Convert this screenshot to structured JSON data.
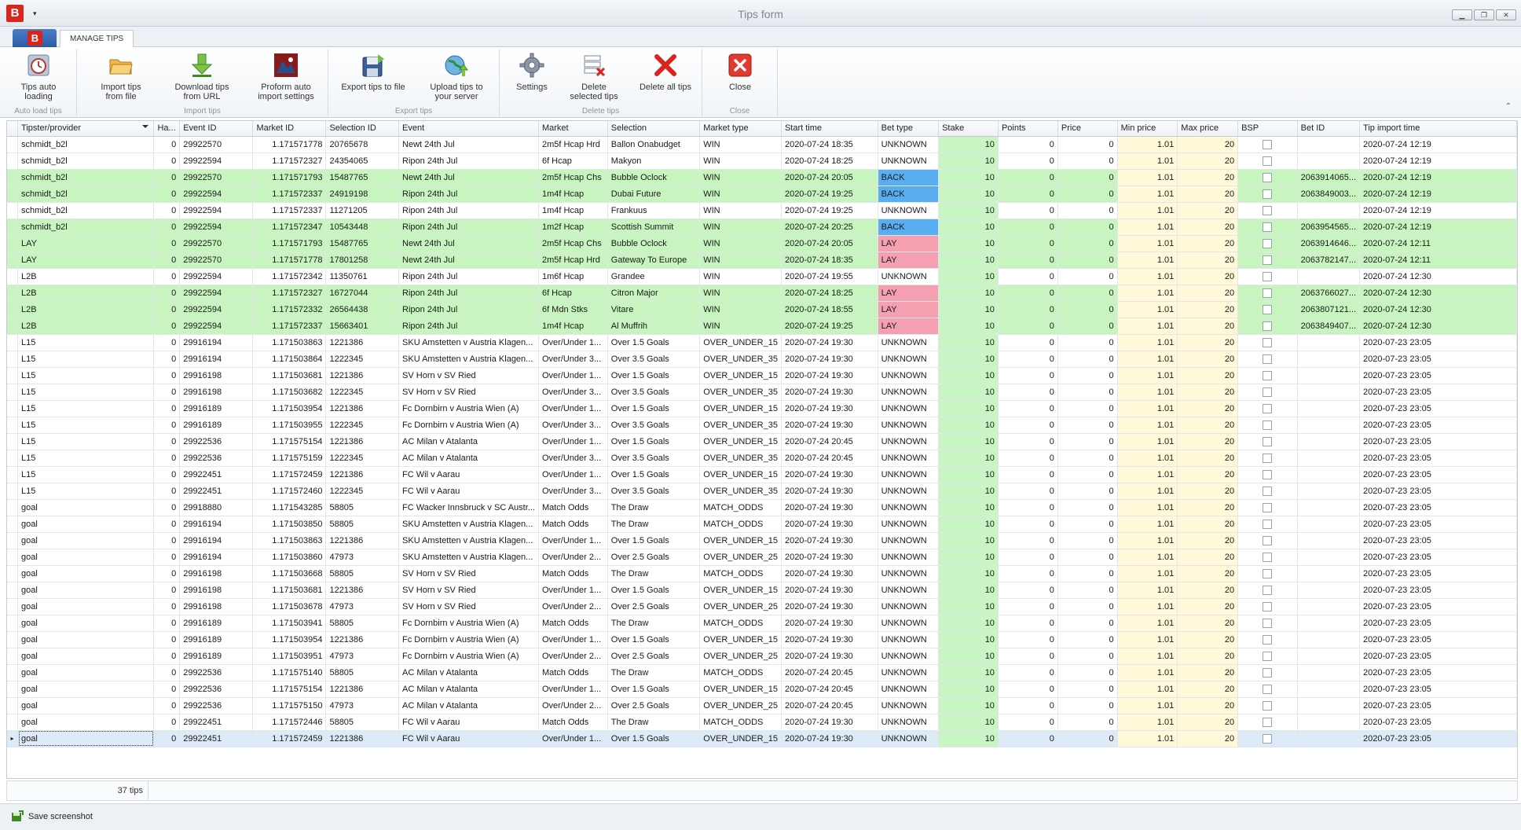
{
  "window": {
    "title": "Tips form",
    "logo_letter": "B",
    "qat_arrow": "▾",
    "min": "▁",
    "restore": "❐",
    "close": "✕"
  },
  "ribbon": {
    "app_button_letter": "B",
    "tab_label": "MANAGE TIPS",
    "groups": {
      "auto_load": {
        "label": "Auto load tips",
        "btn1": "Tips auto\nloading"
      },
      "import": {
        "label": "Import tips",
        "btn1": "Import tips\nfrom file",
        "btn2": "Download tips\nfrom URL",
        "btn3": "Proform auto\nimport settings"
      },
      "export": {
        "label": "Export tips",
        "btn1": "Export tips to file",
        "btn2": "Upload tips to\nyour server"
      },
      "delete": {
        "label": "Delete tips",
        "btn1": "Settings",
        "btn2": "Delete\nselected tips",
        "btn3": "Delete all tips"
      },
      "close": {
        "label": "Close",
        "btn1": "Close"
      }
    },
    "collapse": "⌃"
  },
  "grid": {
    "columns": [
      "",
      "Tipster/provider",
      "Ha...",
      "Event ID",
      "Market ID",
      "Selection ID",
      "Event",
      "Market",
      "Selection",
      "Market type",
      "Start time",
      "Bet type",
      "Stake",
      "Points",
      "Price",
      "Min price",
      "Max price",
      "BSP",
      "Bet ID",
      "Tip import time"
    ],
    "rows": [
      {
        "g": 0,
        "c": [
          "schmidt_b2l",
          "0",
          "29922570",
          "1.171571778",
          "20765678",
          "Newt  24th Jul",
          "2m5f Hcap Hrd",
          "Ballon Onabudget",
          "WIN",
          "2020-07-24 18:35",
          "UNKNOWN",
          "10",
          "0",
          "0",
          "1.01",
          "20",
          "",
          "",
          "2020-07-24 12:19"
        ]
      },
      {
        "g": 0,
        "c": [
          "schmidt_b2l",
          "0",
          "29922594",
          "1.171572327",
          "24354065",
          "Ripon 24th Jul",
          "6f Hcap",
          "Makyon",
          "WIN",
          "2020-07-24 18:25",
          "UNKNOWN",
          "10",
          "0",
          "0",
          "1.01",
          "20",
          "",
          "",
          "2020-07-24 12:19"
        ]
      },
      {
        "g": 1,
        "c": [
          "schmidt_b2l",
          "0",
          "29922570",
          "1.171571793",
          "15487765",
          "Newt  24th Jul",
          "2m5f Hcap Chs",
          "Bubble Oclock",
          "WIN",
          "2020-07-24 20:05",
          "BACK",
          "10",
          "0",
          "0",
          "1.01",
          "20",
          "",
          "2063914065...",
          "2020-07-24 12:19"
        ]
      },
      {
        "g": 1,
        "c": [
          "schmidt_b2l",
          "0",
          "29922594",
          "1.171572337",
          "24919198",
          "Ripon 24th Jul",
          "1m4f Hcap",
          "Dubai Future",
          "WIN",
          "2020-07-24 19:25",
          "BACK",
          "10",
          "0",
          "0",
          "1.01",
          "20",
          "",
          "2063849003...",
          "2020-07-24 12:19"
        ]
      },
      {
        "g": 0,
        "c": [
          "schmidt_b2l",
          "0",
          "29922594",
          "1.171572337",
          "11271205",
          "Ripon 24th Jul",
          "1m4f Hcap",
          "Frankuus",
          "WIN",
          "2020-07-24 19:25",
          "UNKNOWN",
          "10",
          "0",
          "0",
          "1.01",
          "20",
          "",
          "",
          "2020-07-24 12:19"
        ]
      },
      {
        "g": 1,
        "c": [
          "schmidt_b2l",
          "0",
          "29922594",
          "1.171572347",
          "10543448",
          "Ripon 24th Jul",
          "1m2f Hcap",
          "Scottish Summit",
          "WIN",
          "2020-07-24 20:25",
          "BACK",
          "10",
          "0",
          "0",
          "1.01",
          "20",
          "",
          "2063954565...",
          "2020-07-24 12:19"
        ]
      },
      {
        "g": 1,
        "c": [
          "LAY",
          "0",
          "29922570",
          "1.171571793",
          "15487765",
          "Newt  24th Jul",
          "2m5f Hcap Chs",
          "Bubble Oclock",
          "WIN",
          "2020-07-24 20:05",
          "LAY",
          "10",
          "0",
          "0",
          "1.01",
          "20",
          "",
          "2063914646...",
          "2020-07-24 12:11"
        ]
      },
      {
        "g": 1,
        "c": [
          "LAY",
          "0",
          "29922570",
          "1.171571778",
          "17801258",
          "Newt  24th Jul",
          "2m5f Hcap Hrd",
          "Gateway To Europe",
          "WIN",
          "2020-07-24 18:35",
          "LAY",
          "10",
          "0",
          "0",
          "1.01",
          "20",
          "",
          "2063782147...",
          "2020-07-24 12:11"
        ]
      },
      {
        "g": 0,
        "c": [
          "L2B",
          "0",
          "29922594",
          "1.171572342",
          "11350761",
          "Ripon 24th Jul",
          "1m6f Hcap",
          "Grandee",
          "WIN",
          "2020-07-24 19:55",
          "UNKNOWN",
          "10",
          "0",
          "0",
          "1.01",
          "20",
          "",
          "",
          "2020-07-24 12:30"
        ]
      },
      {
        "g": 1,
        "c": [
          "L2B",
          "0",
          "29922594",
          "1.171572327",
          "16727044",
          "Ripon 24th Jul",
          "6f Hcap",
          "Citron Major",
          "WIN",
          "2020-07-24 18:25",
          "LAY",
          "10",
          "0",
          "0",
          "1.01",
          "20",
          "",
          "2063766027...",
          "2020-07-24 12:30"
        ]
      },
      {
        "g": 1,
        "c": [
          "L2B",
          "0",
          "29922594",
          "1.171572332",
          "26564438",
          "Ripon 24th Jul",
          "6f Mdn Stks",
          "Vitare",
          "WIN",
          "2020-07-24 18:55",
          "LAY",
          "10",
          "0",
          "0",
          "1.01",
          "20",
          "",
          "2063807121...",
          "2020-07-24 12:30"
        ]
      },
      {
        "g": 1,
        "c": [
          "L2B",
          "0",
          "29922594",
          "1.171572337",
          "15663401",
          "Ripon 24th Jul",
          "1m4f Hcap",
          "Al Muffrih",
          "WIN",
          "2020-07-24 19:25",
          "LAY",
          "10",
          "0",
          "0",
          "1.01",
          "20",
          "",
          "2063849407...",
          "2020-07-24 12:30"
        ]
      },
      {
        "g": 0,
        "c": [
          "L15",
          "0",
          "29916194",
          "1.171503863",
          "1221386",
          "SKU Amstetten v Austria Klagen...",
          "Over/Under 1...",
          "Over 1.5 Goals",
          "OVER_UNDER_15",
          "2020-07-24 19:30",
          "UNKNOWN",
          "10",
          "0",
          "0",
          "1.01",
          "20",
          "",
          "",
          "2020-07-23 23:05"
        ]
      },
      {
        "g": 0,
        "c": [
          "L15",
          "0",
          "29916194",
          "1.171503864",
          "1222345",
          "SKU Amstetten v Austria Klagen...",
          "Over/Under 3...",
          "Over 3.5 Goals",
          "OVER_UNDER_35",
          "2020-07-24 19:30",
          "UNKNOWN",
          "10",
          "0",
          "0",
          "1.01",
          "20",
          "",
          "",
          "2020-07-23 23:05"
        ]
      },
      {
        "g": 0,
        "c": [
          "L15",
          "0",
          "29916198",
          "1.171503681",
          "1221386",
          "SV Horn v SV Ried",
          "Over/Under 1...",
          "Over 1.5 Goals",
          "OVER_UNDER_15",
          "2020-07-24 19:30",
          "UNKNOWN",
          "10",
          "0",
          "0",
          "1.01",
          "20",
          "",
          "",
          "2020-07-23 23:05"
        ]
      },
      {
        "g": 0,
        "c": [
          "L15",
          "0",
          "29916198",
          "1.171503682",
          "1222345",
          "SV Horn v SV Ried",
          "Over/Under 3...",
          "Over 3.5 Goals",
          "OVER_UNDER_35",
          "2020-07-24 19:30",
          "UNKNOWN",
          "10",
          "0",
          "0",
          "1.01",
          "20",
          "",
          "",
          "2020-07-23 23:05"
        ]
      },
      {
        "g": 0,
        "c": [
          "L15",
          "0",
          "29916189",
          "1.171503954",
          "1221386",
          "Fc Dornbirn v Austria Wien (A)",
          "Over/Under 1...",
          "Over 1.5 Goals",
          "OVER_UNDER_15",
          "2020-07-24 19:30",
          "UNKNOWN",
          "10",
          "0",
          "0",
          "1.01",
          "20",
          "",
          "",
          "2020-07-23 23:05"
        ]
      },
      {
        "g": 0,
        "c": [
          "L15",
          "0",
          "29916189",
          "1.171503955",
          "1222345",
          "Fc Dornbirn v Austria Wien (A)",
          "Over/Under 3...",
          "Over 3.5 Goals",
          "OVER_UNDER_35",
          "2020-07-24 19:30",
          "UNKNOWN",
          "10",
          "0",
          "0",
          "1.01",
          "20",
          "",
          "",
          "2020-07-23 23:05"
        ]
      },
      {
        "g": 0,
        "c": [
          "L15",
          "0",
          "29922536",
          "1.171575154",
          "1221386",
          "AC Milan v Atalanta",
          "Over/Under 1...",
          "Over 1.5 Goals",
          "OVER_UNDER_15",
          "2020-07-24 20:45",
          "UNKNOWN",
          "10",
          "0",
          "0",
          "1.01",
          "20",
          "",
          "",
          "2020-07-23 23:05"
        ]
      },
      {
        "g": 0,
        "c": [
          "L15",
          "0",
          "29922536",
          "1.171575159",
          "1222345",
          "AC Milan v Atalanta",
          "Over/Under 3...",
          "Over 3.5 Goals",
          "OVER_UNDER_35",
          "2020-07-24 20:45",
          "UNKNOWN",
          "10",
          "0",
          "0",
          "1.01",
          "20",
          "",
          "",
          "2020-07-23 23:05"
        ]
      },
      {
        "g": 0,
        "c": [
          "L15",
          "0",
          "29922451",
          "1.171572459",
          "1221386",
          "FC Wil v Aarau",
          "Over/Under 1...",
          "Over 1.5 Goals",
          "OVER_UNDER_15",
          "2020-07-24 19:30",
          "UNKNOWN",
          "10",
          "0",
          "0",
          "1.01",
          "20",
          "",
          "",
          "2020-07-23 23:05"
        ]
      },
      {
        "g": 0,
        "c": [
          "L15",
          "0",
          "29922451",
          "1.171572460",
          "1222345",
          "FC Wil v Aarau",
          "Over/Under 3...",
          "Over 3.5 Goals",
          "OVER_UNDER_35",
          "2020-07-24 19:30",
          "UNKNOWN",
          "10",
          "0",
          "0",
          "1.01",
          "20",
          "",
          "",
          "2020-07-23 23:05"
        ]
      },
      {
        "g": 0,
        "c": [
          "goal",
          "0",
          "29918880",
          "1.171543285",
          "58805",
          "FC Wacker Innsbruck v SC Austr...",
          "Match Odds",
          "The Draw",
          "MATCH_ODDS",
          "2020-07-24 19:30",
          "UNKNOWN",
          "10",
          "0",
          "0",
          "1.01",
          "20",
          "",
          "",
          "2020-07-23 23:05"
        ]
      },
      {
        "g": 0,
        "c": [
          "goal",
          "0",
          "29916194",
          "1.171503850",
          "58805",
          "SKU Amstetten v Austria Klagen...",
          "Match Odds",
          "The Draw",
          "MATCH_ODDS",
          "2020-07-24 19:30",
          "UNKNOWN",
          "10",
          "0",
          "0",
          "1.01",
          "20",
          "",
          "",
          "2020-07-23 23:05"
        ]
      },
      {
        "g": 0,
        "c": [
          "goal",
          "0",
          "29916194",
          "1.171503863",
          "1221386",
          "SKU Amstetten v Austria Klagen...",
          "Over/Under 1...",
          "Over 1.5 Goals",
          "OVER_UNDER_15",
          "2020-07-24 19:30",
          "UNKNOWN",
          "10",
          "0",
          "0",
          "1.01",
          "20",
          "",
          "",
          "2020-07-23 23:05"
        ]
      },
      {
        "g": 0,
        "c": [
          "goal",
          "0",
          "29916194",
          "1.171503860",
          "47973",
          "SKU Amstetten v Austria Klagen...",
          "Over/Under 2...",
          "Over 2.5 Goals",
          "OVER_UNDER_25",
          "2020-07-24 19:30",
          "UNKNOWN",
          "10",
          "0",
          "0",
          "1.01",
          "20",
          "",
          "",
          "2020-07-23 23:05"
        ]
      },
      {
        "g": 0,
        "c": [
          "goal",
          "0",
          "29916198",
          "1.171503668",
          "58805",
          "SV Horn v SV Ried",
          "Match Odds",
          "The Draw",
          "MATCH_ODDS",
          "2020-07-24 19:30",
          "UNKNOWN",
          "10",
          "0",
          "0",
          "1.01",
          "20",
          "",
          "",
          "2020-07-23 23:05"
        ]
      },
      {
        "g": 0,
        "c": [
          "goal",
          "0",
          "29916198",
          "1.171503681",
          "1221386",
          "SV Horn v SV Ried",
          "Over/Under 1...",
          "Over 1.5 Goals",
          "OVER_UNDER_15",
          "2020-07-24 19:30",
          "UNKNOWN",
          "10",
          "0",
          "0",
          "1.01",
          "20",
          "",
          "",
          "2020-07-23 23:05"
        ]
      },
      {
        "g": 0,
        "c": [
          "goal",
          "0",
          "29916198",
          "1.171503678",
          "47973",
          "SV Horn v SV Ried",
          "Over/Under 2...",
          "Over 2.5 Goals",
          "OVER_UNDER_25",
          "2020-07-24 19:30",
          "UNKNOWN",
          "10",
          "0",
          "0",
          "1.01",
          "20",
          "",
          "",
          "2020-07-23 23:05"
        ]
      },
      {
        "g": 0,
        "c": [
          "goal",
          "0",
          "29916189",
          "1.171503941",
          "58805",
          "Fc Dornbirn v Austria Wien (A)",
          "Match Odds",
          "The Draw",
          "MATCH_ODDS",
          "2020-07-24 19:30",
          "UNKNOWN",
          "10",
          "0",
          "0",
          "1.01",
          "20",
          "",
          "",
          "2020-07-23 23:05"
        ]
      },
      {
        "g": 0,
        "c": [
          "goal",
          "0",
          "29916189",
          "1.171503954",
          "1221386",
          "Fc Dornbirn v Austria Wien (A)",
          "Over/Under 1...",
          "Over 1.5 Goals",
          "OVER_UNDER_15",
          "2020-07-24 19:30",
          "UNKNOWN",
          "10",
          "0",
          "0",
          "1.01",
          "20",
          "",
          "",
          "2020-07-23 23:05"
        ]
      },
      {
        "g": 0,
        "c": [
          "goal",
          "0",
          "29916189",
          "1.171503951",
          "47973",
          "Fc Dornbirn v Austria Wien (A)",
          "Over/Under 2...",
          "Over 2.5 Goals",
          "OVER_UNDER_25",
          "2020-07-24 19:30",
          "UNKNOWN",
          "10",
          "0",
          "0",
          "1.01",
          "20",
          "",
          "",
          "2020-07-23 23:05"
        ]
      },
      {
        "g": 0,
        "c": [
          "goal",
          "0",
          "29922536",
          "1.171575140",
          "58805",
          "AC Milan v Atalanta",
          "Match Odds",
          "The Draw",
          "MATCH_ODDS",
          "2020-07-24 20:45",
          "UNKNOWN",
          "10",
          "0",
          "0",
          "1.01",
          "20",
          "",
          "",
          "2020-07-23 23:05"
        ]
      },
      {
        "g": 0,
        "c": [
          "goal",
          "0",
          "29922536",
          "1.171575154",
          "1221386",
          "AC Milan v Atalanta",
          "Over/Under 1...",
          "Over 1.5 Goals",
          "OVER_UNDER_15",
          "2020-07-24 20:45",
          "UNKNOWN",
          "10",
          "0",
          "0",
          "1.01",
          "20",
          "",
          "",
          "2020-07-23 23:05"
        ]
      },
      {
        "g": 0,
        "c": [
          "goal",
          "0",
          "29922536",
          "1.171575150",
          "47973",
          "AC Milan v Atalanta",
          "Over/Under 2...",
          "Over 2.5 Goals",
          "OVER_UNDER_25",
          "2020-07-24 20:45",
          "UNKNOWN",
          "10",
          "0",
          "0",
          "1.01",
          "20",
          "",
          "",
          "2020-07-23 23:05"
        ]
      },
      {
        "g": 0,
        "c": [
          "goal",
          "0",
          "29922451",
          "1.171572446",
          "58805",
          "FC Wil v Aarau",
          "Match Odds",
          "The Draw",
          "MATCH_ODDS",
          "2020-07-24 19:30",
          "UNKNOWN",
          "10",
          "0",
          "0",
          "1.01",
          "20",
          "",
          "",
          "2020-07-23 23:05"
        ]
      },
      {
        "g": 2,
        "c": [
          "goal",
          "0",
          "29922451",
          "1.171572459",
          "1221386",
          "FC Wil v Aarau",
          "Over/Under 1...",
          "Over 1.5 Goals",
          "OVER_UNDER_15",
          "2020-07-24 19:30",
          "UNKNOWN",
          "10",
          "0",
          "0",
          "1.01",
          "20",
          "",
          "",
          "2020-07-23 23:05"
        ]
      }
    ],
    "row_indicator": "▸"
  },
  "footer": {
    "count": "37 tips"
  },
  "status": {
    "save_label": "Save screenshot"
  },
  "colors": {
    "green_row": "#c8f4c0",
    "back": "#58aef0",
    "lay": "#f4a0b0",
    "stake": "#c9f5c4",
    "price_range": "#fff9d9"
  }
}
